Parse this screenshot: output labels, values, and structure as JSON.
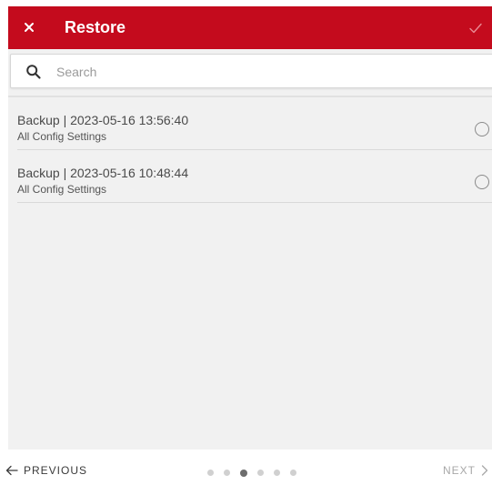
{
  "header": {
    "title": "Restore",
    "close_icon": "close-icon",
    "confirm_icon": "checkmark-icon",
    "bg_color": "#c40b1d"
  },
  "search": {
    "placeholder": "Search",
    "value": "",
    "icon": "search-icon"
  },
  "backups": [
    {
      "title": "Backup | 2023-05-16 13:56:40",
      "subtitle": "All Config Settings",
      "selected": false
    },
    {
      "title": "Backup | 2023-05-16 10:48:44",
      "subtitle": "All Config Settings",
      "selected": false
    }
  ],
  "footer": {
    "previous_label": "PREVIOUS",
    "next_label": "NEXT",
    "step_count": 6,
    "current_step": 3
  }
}
